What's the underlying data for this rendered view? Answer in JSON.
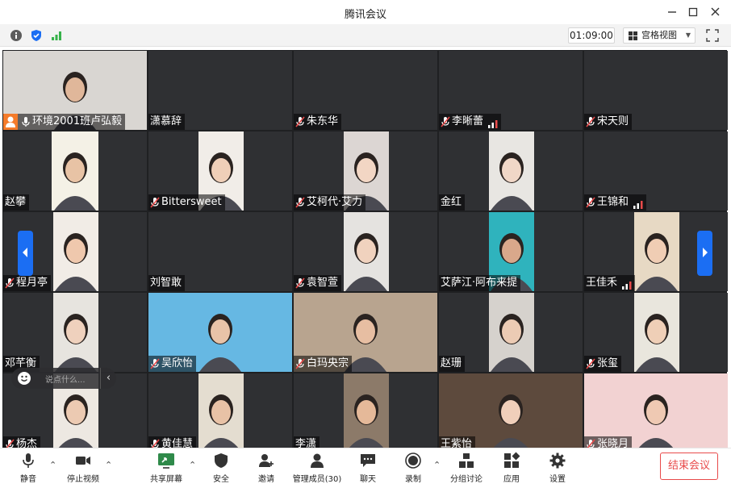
{
  "window": {
    "title": "腾讯会议",
    "controls": [
      "minimize",
      "maximize",
      "close"
    ]
  },
  "infobar": {
    "icons": [
      "info-icon",
      "shield-icon",
      "signal-icon"
    ],
    "timer": "01:09:00",
    "view_label": "宫格视图",
    "fullscreen_icon": "fullscreen-icon"
  },
  "colors": {
    "accent": "#1b6ef3",
    "host_badge": "#f57b2a",
    "end_meeting": "#e84a4a",
    "signal_green": "#36b24a"
  },
  "participants": [
    {
      "name": "环境2001班卢弘毅",
      "muted": false,
      "host": true,
      "has_video": true,
      "signal": false
    },
    {
      "name": "潇慕辞",
      "muted": false,
      "host": false,
      "has_video": false,
      "signal": false
    },
    {
      "name": "朱东华",
      "muted": true,
      "host": false,
      "has_video": false,
      "signal": false
    },
    {
      "name": "李晰蕾",
      "muted": true,
      "host": false,
      "has_video": false,
      "signal": true
    },
    {
      "name": "宋天则",
      "muted": true,
      "host": false,
      "has_video": false,
      "signal": false
    },
    {
      "name": "赵攀",
      "muted": false,
      "host": false,
      "has_video": true,
      "signal": false
    },
    {
      "name": "Bittersweet",
      "muted": true,
      "host": false,
      "has_video": true,
      "signal": false
    },
    {
      "name": "艾柯代·艾力",
      "muted": true,
      "host": false,
      "has_video": true,
      "signal": false
    },
    {
      "name": "金红",
      "muted": false,
      "host": false,
      "has_video": true,
      "signal": false
    },
    {
      "name": "王锦和",
      "muted": true,
      "host": false,
      "has_video": false,
      "signal": true
    },
    {
      "name": "程月亭",
      "muted": true,
      "host": false,
      "has_video": true,
      "signal": false
    },
    {
      "name": "刘智敢",
      "muted": false,
      "host": false,
      "has_video": false,
      "signal": false
    },
    {
      "name": "袁智萱",
      "muted": true,
      "host": false,
      "has_video": true,
      "signal": false
    },
    {
      "name": "艾萨江·阿布来提",
      "muted": false,
      "host": false,
      "has_video": true,
      "signal": false
    },
    {
      "name": "王佳禾",
      "muted": false,
      "host": false,
      "has_video": true,
      "signal": true
    },
    {
      "name": "邓芊衡",
      "muted": false,
      "host": false,
      "has_video": true,
      "signal": false
    },
    {
      "name": "吴欣怡",
      "muted": true,
      "host": false,
      "has_video": true,
      "signal": false
    },
    {
      "name": "白玛央宗",
      "muted": true,
      "host": false,
      "has_video": true,
      "signal": false
    },
    {
      "name": "赵珊",
      "muted": false,
      "host": false,
      "has_video": true,
      "signal": false
    },
    {
      "name": "张玺",
      "muted": true,
      "host": false,
      "has_video": true,
      "signal": false
    },
    {
      "name": "杨杰",
      "muted": true,
      "host": false,
      "has_video": true,
      "signal": false
    },
    {
      "name": "黄佳慧",
      "muted": true,
      "host": false,
      "has_video": true,
      "signal": false
    },
    {
      "name": "李潇",
      "muted": false,
      "host": false,
      "has_video": true,
      "signal": false
    },
    {
      "name": "王紫怡",
      "muted": false,
      "host": false,
      "has_video": true,
      "signal": false
    },
    {
      "name": "张晓月",
      "muted": true,
      "host": false,
      "has_video": true,
      "signal": false
    }
  ],
  "chat": {
    "placeholder": "说点什么..."
  },
  "toolbar": {
    "mute": "静音",
    "stop_video": "停止视频",
    "share_screen": "共享屏幕",
    "security": "安全",
    "invite": "邀请",
    "manage_members": "管理成员(30)",
    "chat": "聊天",
    "record": "录制",
    "breakout": "分组讨论",
    "apps": "应用",
    "settings": "设置",
    "end_meeting": "结束会议"
  }
}
